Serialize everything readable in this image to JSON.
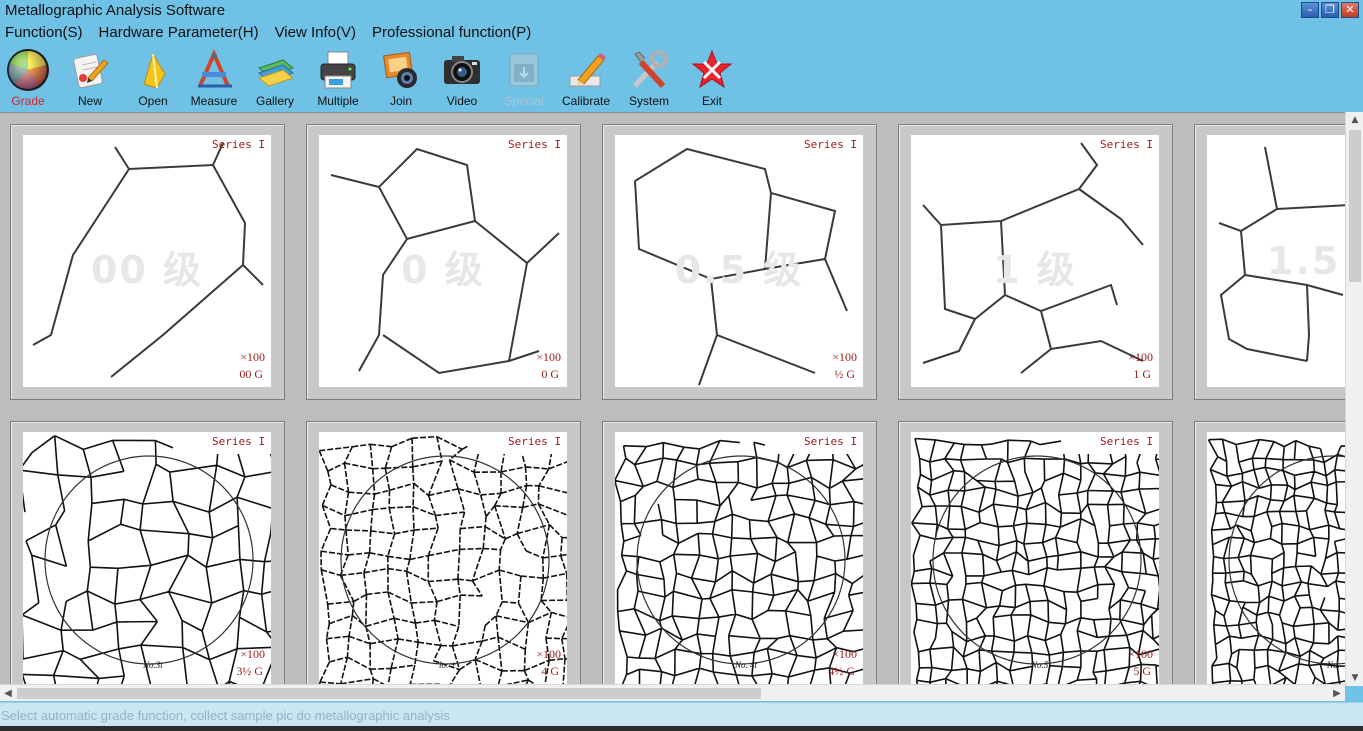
{
  "window": {
    "title": "Metallographic Analysis Software"
  },
  "window_controls": {
    "minimize": "–",
    "restore": "❐",
    "close": "✕"
  },
  "menu": [
    {
      "label": "Function(S)"
    },
    {
      "label": "Hardware Parameter(H)"
    },
    {
      "label": "View Info(V)"
    },
    {
      "label": "Professional function(P)"
    }
  ],
  "toolbar": [
    {
      "label": "Grade",
      "icon": "color-wheel-icon",
      "state": "active"
    },
    {
      "label": "New",
      "icon": "new-document-icon"
    },
    {
      "label": "Open",
      "icon": "open-folder-icon"
    },
    {
      "label": "Measure",
      "icon": "measure-ruler-icon"
    },
    {
      "label": "Gallery",
      "icon": "gallery-icon"
    },
    {
      "label": "Multiple",
      "icon": "printer-icon"
    },
    {
      "label": "Join",
      "icon": "photo-join-icon"
    },
    {
      "label": "Video",
      "icon": "camera-icon"
    },
    {
      "label": "Special",
      "icon": "special-box-icon",
      "state": "disabled"
    },
    {
      "label": "Calibrate",
      "icon": "calibrate-pencil-icon"
    },
    {
      "label": "System",
      "icon": "tools-icon"
    },
    {
      "label": "Exit",
      "icon": "exit-star-icon"
    }
  ],
  "cards": [
    {
      "series": "Series I",
      "magnification": "×100",
      "grade": "00 G",
      "watermark": "00 级",
      "note": ""
    },
    {
      "series": "Series I",
      "magnification": "×100",
      "grade": "0 G",
      "watermark": "0 级",
      "note": ""
    },
    {
      "series": "Series I",
      "magnification": "×100",
      "grade": "½ G",
      "watermark": "0.5 级",
      "note": ""
    },
    {
      "series": "Series I",
      "magnification": "×100",
      "grade": "1 G",
      "watermark": "1 级",
      "note": ""
    },
    {
      "series": "",
      "magnification": "",
      "grade": "",
      "watermark": "1.5",
      "note": ""
    },
    {
      "series": "Series I",
      "magnification": "×100",
      "grade": "3½ G",
      "watermark": "",
      "note": "No.3t"
    },
    {
      "series": "Series I",
      "magnification": "×100",
      "grade": "4 G",
      "watermark": "",
      "note": "lo. +"
    },
    {
      "series": "Series I",
      "magnification": "×100",
      "grade": "4½ G",
      "watermark": "",
      "note": "No. 4t"
    },
    {
      "series": "Series I",
      "magnification": "×100",
      "grade": "5 G",
      "watermark": "",
      "note": "No.5"
    },
    {
      "series": "",
      "magnification": "",
      "grade": "",
      "watermark": "",
      "note": "No."
    }
  ],
  "status": {
    "text": "Select automatic grade function, collect sample pic do metallographic analysis"
  },
  "colors": {
    "titlebar": "#6fc1e6",
    "label_red": "#9a1a1a",
    "active_label": "#d9242b",
    "status_text": "#8fb3c6"
  }
}
